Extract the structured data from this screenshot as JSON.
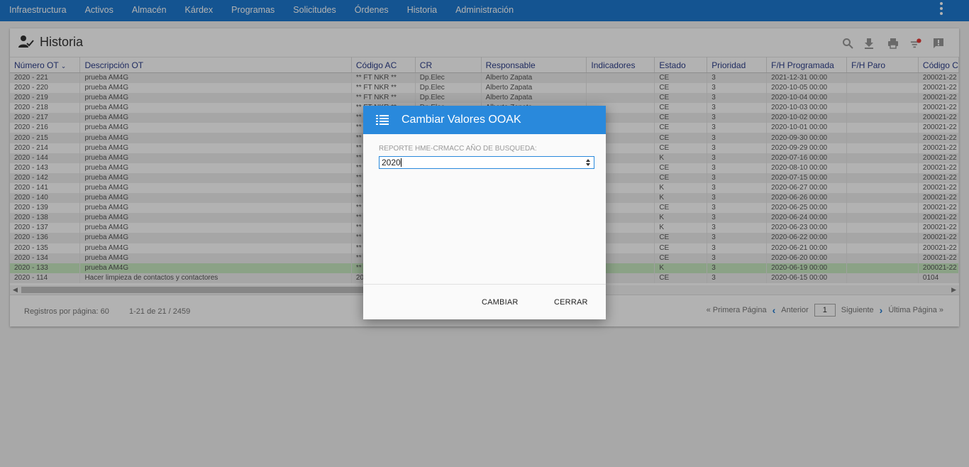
{
  "nav": {
    "items": [
      "Infraestructura",
      "Activos",
      "Almacén",
      "Kárdex",
      "Programas",
      "Solicitudes",
      "Órdenes",
      "Historia",
      "Administración"
    ]
  },
  "page": {
    "title": "Historia",
    "columns": [
      "Número OT",
      "Descripción OT",
      "Código AC",
      "CR",
      "Responsable",
      "Indicadores",
      "Estado",
      "Prioridad",
      "F/H Programada",
      "F/H Paro",
      "Código C"
    ],
    "rows": [
      [
        "2020 - 221",
        "prueba AM4G",
        "** FT NKR **",
        "Dp.Elec",
        "Alberto Zapata",
        "",
        "CE",
        "3",
        "2021-12-31 00:00",
        "",
        "200021-22"
      ],
      [
        "2020 - 220",
        "prueba AM4G",
        "** FT NKR **",
        "Dp.Elec",
        "Alberto Zapata",
        "",
        "CE",
        "3",
        "2020-10-05 00:00",
        "",
        "200021-22"
      ],
      [
        "2020 - 219",
        "prueba AM4G",
        "** FT NKR **",
        "Dp.Elec",
        "Alberto Zapata",
        "",
        "CE",
        "3",
        "2020-10-04 00:00",
        "",
        "200021-22"
      ],
      [
        "2020 - 218",
        "prueba AM4G",
        "** FT NKR **",
        "Dp.Elec",
        "Alberto Zapata",
        "",
        "CE",
        "3",
        "2020-10-03 00:00",
        "",
        "200021-22"
      ],
      [
        "2020 - 217",
        "prueba AM4G",
        "**",
        "",
        "",
        "",
        "CE",
        "3",
        "2020-10-02 00:00",
        "",
        "200021-22"
      ],
      [
        "2020 - 216",
        "prueba AM4G",
        "**",
        "",
        "",
        "",
        "CE",
        "3",
        "2020-10-01 00:00",
        "",
        "200021-22"
      ],
      [
        "2020 - 215",
        "prueba AM4G",
        "**",
        "",
        "",
        "",
        "CE",
        "3",
        "2020-09-30 00:00",
        "",
        "200021-22"
      ],
      [
        "2020 - 214",
        "prueba AM4G",
        "**",
        "",
        "",
        "",
        "CE",
        "3",
        "2020-09-29 00:00",
        "",
        "200021-22"
      ],
      [
        "2020 - 144",
        "prueba AM4G",
        "**",
        "",
        "",
        "",
        "K",
        "3",
        "2020-07-16 00:00",
        "",
        "200021-22"
      ],
      [
        "2020 - 143",
        "prueba AM4G",
        "**",
        "",
        "",
        "",
        "CE",
        "3",
        "2020-08-10 00:00",
        "",
        "200021-22"
      ],
      [
        "2020 - 142",
        "prueba AM4G",
        "**",
        "",
        "",
        "",
        "CE",
        "3",
        "2020-07-15 00:00",
        "",
        "200021-22"
      ],
      [
        "2020 - 141",
        "prueba AM4G",
        "**",
        "",
        "",
        "",
        "K",
        "3",
        "2020-06-27 00:00",
        "",
        "200021-22"
      ],
      [
        "2020 - 140",
        "prueba AM4G",
        "**",
        "",
        "",
        "",
        "K",
        "3",
        "2020-06-26 00:00",
        "",
        "200021-22"
      ],
      [
        "2020 - 139",
        "prueba AM4G",
        "**",
        "",
        "",
        "",
        "CE",
        "3",
        "2020-06-25 00:00",
        "",
        "200021-22"
      ],
      [
        "2020 - 138",
        "prueba AM4G",
        "**",
        "",
        "",
        "",
        "K",
        "3",
        "2020-06-24 00:00",
        "",
        "200021-22"
      ],
      [
        "2020 - 137",
        "prueba AM4G",
        "**",
        "",
        "",
        "",
        "K",
        "3",
        "2020-06-23 00:00",
        "",
        "200021-22"
      ],
      [
        "2020 - 136",
        "prueba AM4G",
        "**",
        "",
        "",
        "",
        "CE",
        "3",
        "2020-06-22 00:00",
        "",
        "200021-22"
      ],
      [
        "2020 - 135",
        "prueba AM4G",
        "**",
        "",
        "",
        "",
        "CE",
        "3",
        "2020-06-21 00:00",
        "",
        "200021-22"
      ],
      [
        "2020 - 134",
        "prueba AM4G",
        "**",
        "",
        "",
        "",
        "CE",
        "3",
        "2020-06-20 00:00",
        "",
        "200021-22"
      ],
      [
        "2020 - 133",
        "prueba AM4G",
        "**",
        "",
        "",
        "",
        "K",
        "3",
        "2020-06-19 00:00",
        "",
        "200021-22"
      ],
      [
        "2020 - 114",
        "Hacer limpieza de contactos y contactores",
        "20",
        "",
        "",
        "",
        "CE",
        "3",
        "2020-06-15 00:00",
        "",
        "0104"
      ]
    ],
    "highlight_row": 19,
    "footer": {
      "per_page": "Registros por página: 60",
      "range": "1-21 de 21 / 2459",
      "first": "« Primera Página",
      "prev": "Anterior",
      "page": "1",
      "next": "Siguiente",
      "last": "Última Página »"
    }
  },
  "dialog": {
    "title": "Cambiar Valores OOAK",
    "label": "REPORTE HME-CRMACC AÑO DE BUSQUEDA:",
    "value": "2020",
    "btn_change": "CAMBIAR",
    "btn_close": "CERRAR"
  },
  "colors": {
    "nav": "#1e79d0",
    "dialog_header": "#2989dc",
    "highlight": "#c7e8c0",
    "notification_dot": "#e53935"
  }
}
